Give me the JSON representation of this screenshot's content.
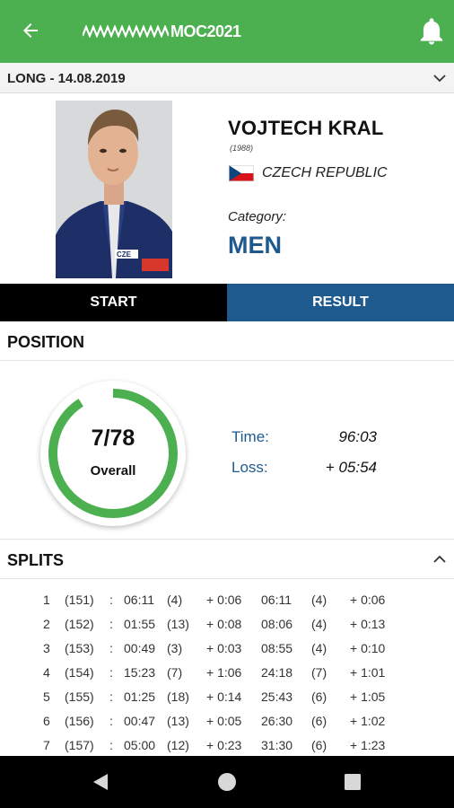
{
  "app": {
    "logo_text": "MOC2021"
  },
  "race": {
    "label": "LONG - 14.08.2019"
  },
  "athlete": {
    "name": "VOJTECH KRAL",
    "year": "(1988)",
    "country": "CZECH REPUBLIC",
    "category_label": "Category:",
    "category": "MEN",
    "jersey_text": "CZE"
  },
  "tabs": {
    "start": "START",
    "result": "RESULT"
  },
  "position": {
    "heading": "POSITION",
    "rank": "7/78",
    "rank_label": "Overall",
    "rank_fraction": 0.91,
    "time_label": "Time:",
    "time_value": "96:03",
    "loss_label": "Loss:",
    "loss_value": "+ 05:54"
  },
  "splits": {
    "heading": "SPLITS",
    "rows": [
      {
        "idx": "1",
        "control": "(151)",
        "sep": ":",
        "split": "06:11",
        "split_rank": "(4)",
        "split_loss": "+ 0:06",
        "total": "06:11",
        "total_rank": "(4)",
        "total_loss": "+ 0:06"
      },
      {
        "idx": "2",
        "control": "(152)",
        "sep": ":",
        "split": "01:55",
        "split_rank": "(13)",
        "split_loss": "+ 0:08",
        "total": "08:06",
        "total_rank": "(4)",
        "total_loss": "+ 0:13"
      },
      {
        "idx": "3",
        "control": "(153)",
        "sep": ":",
        "split": "00:49",
        "split_rank": "(3)",
        "split_loss": "+ 0:03",
        "total": "08:55",
        "total_rank": "(4)",
        "total_loss": "+ 0:10"
      },
      {
        "idx": "4",
        "control": "(154)",
        "sep": ":",
        "split": "15:23",
        "split_rank": "(7)",
        "split_loss": "+ 1:06",
        "total": "24:18",
        "total_rank": "(7)",
        "total_loss": "+ 1:01"
      },
      {
        "idx": "5",
        "control": "(155)",
        "sep": ":",
        "split": "01:25",
        "split_rank": "(18)",
        "split_loss": "+ 0:14",
        "total": "25:43",
        "total_rank": "(6)",
        "total_loss": "+ 1:05"
      },
      {
        "idx": "6",
        "control": "(156)",
        "sep": ":",
        "split": "00:47",
        "split_rank": "(13)",
        "split_loss": "+ 0:05",
        "total": "26:30",
        "total_rank": "(6)",
        "total_loss": "+ 1:02"
      },
      {
        "idx": "7",
        "control": "(157)",
        "sep": ":",
        "split": "05:00",
        "split_rank": "(12)",
        "split_loss": "+ 0:23",
        "total": "31:30",
        "total_rank": "(6)",
        "total_loss": "+ 1:23"
      }
    ]
  },
  "icons": {
    "back": "arrow-left",
    "notifications": "bell",
    "race_toggle": "chevron-down",
    "splits_toggle": "chevron-up",
    "nav_back": "triangle-left",
    "nav_home": "circle",
    "nav_recents": "square"
  },
  "colors": {
    "primary_green": "#4caf50",
    "accent_blue": "#1e5a8e",
    "tab_active": "#1e5a8e",
    "tab_inactive": "#000000"
  }
}
